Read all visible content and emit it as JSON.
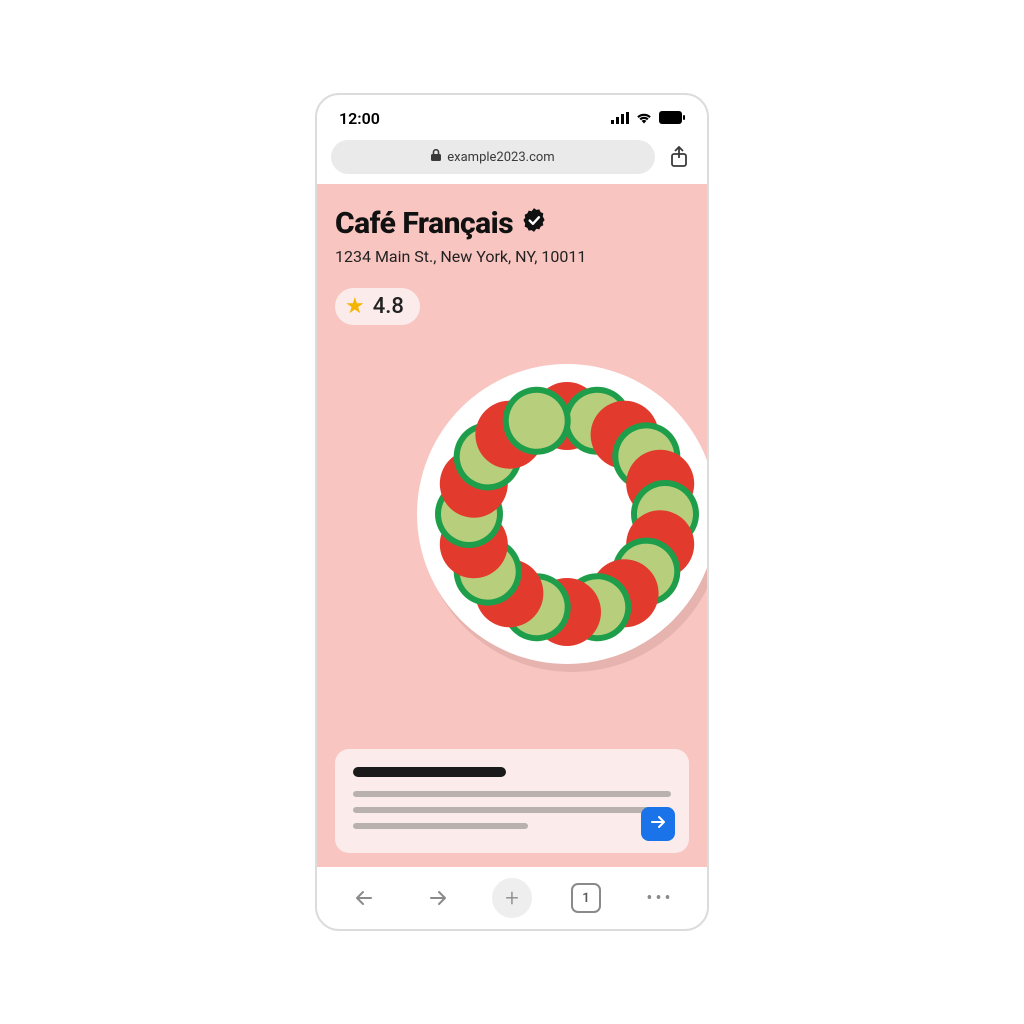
{
  "status": {
    "time": "12:00"
  },
  "browser": {
    "url": "example2023.com",
    "tab_count": "1"
  },
  "page": {
    "name": "Café Français",
    "address": "1234 Main St., New York, NY, 10011",
    "rating": "4.8"
  }
}
